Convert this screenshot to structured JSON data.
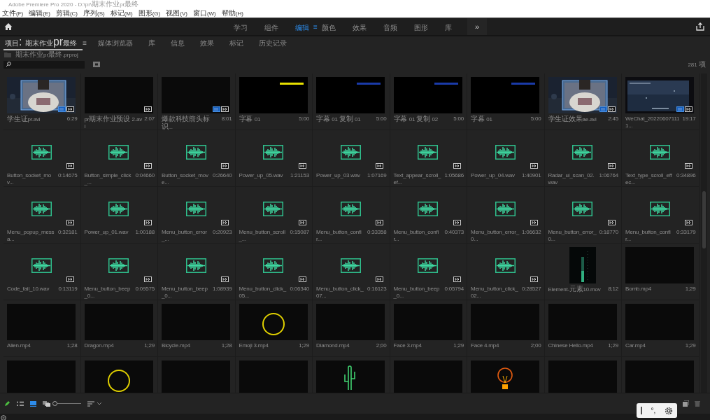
{
  "window": {
    "title": "Adobe Premiere Pro 2020 - D:\\pr\\期末作业pr最终"
  },
  "menu": [
    "文件(F)",
    "编辑(E)",
    "剪辑(C)",
    "序列(S)",
    "标记(M)",
    "图形(G)",
    "视图(V)",
    "窗口(W)",
    "帮助(H)"
  ],
  "workspaces": [
    {
      "label": "学习",
      "selected": false
    },
    {
      "label": "组件",
      "selected": false
    },
    {
      "label": "编辑",
      "selected": true
    },
    {
      "label": "颜色",
      "selected": false
    },
    {
      "label": "效果",
      "selected": false
    },
    {
      "label": "音频",
      "selected": false
    },
    {
      "label": "图形",
      "selected": false
    },
    {
      "label": "库",
      "selected": false
    }
  ],
  "workspace_menu": "≡",
  "workspace_more": "»",
  "panel_tabs": [
    {
      "label": "项目: 期末作业pr最终",
      "selected": true
    },
    {
      "label": "媒体浏览器",
      "selected": false
    },
    {
      "label": "库",
      "selected": false
    },
    {
      "label": "信息",
      "selected": false
    },
    {
      "label": "效果",
      "selected": false
    },
    {
      "label": "标记",
      "selected": false
    },
    {
      "label": "历史记录",
      "selected": false
    }
  ],
  "panel_menu": "≡",
  "project_file": "期末作业pr最终.prproj",
  "item_count": "281 项",
  "items": [
    {
      "name": "学生证pr.avi",
      "duration": "6:29",
      "video_badge": true,
      "audio_badge": true
    },
    {
      "name": "pr期末作业预设 2.avi",
      "duration": "2:07",
      "kind": "black",
      "audio_badge": true
    },
    {
      "name": "爆款科技箭头标识...",
      "duration": "8:01",
      "kind": "black",
      "video_badge": true,
      "audio_badge": true
    },
    {
      "name": "字幕 01",
      "duration": "5:00",
      "kind": "caption",
      "color": "#e8e000"
    },
    {
      "name": "字幕 01 复制 01",
      "duration": "5:00",
      "kind": "caption",
      "color": "#1a3aa8"
    },
    {
      "name": "字幕 01 复制 02",
      "duration": "5:00",
      "kind": "caption",
      "color": "#1a3aa8"
    },
    {
      "name": "字幕 01",
      "duration": "5:00",
      "kind": "caption",
      "color": "#1a3aa8"
    },
    {
      "name": "学生证效果ae.avi",
      "duration": "2:45",
      "video_badge": true,
      "audio_badge": true
    },
    {
      "name": "WeChat_202206071111...",
      "duration": "19:17",
      "kind": "screen",
      "video_badge": true,
      "audio_badge": true
    },
    {
      "name": "Button_socket_mov...",
      "duration": "0:14675",
      "kind": "audio",
      "audio_badge": true
    },
    {
      "name": "Button_simple_click_...",
      "duration": "0:04660",
      "kind": "audio",
      "audio_badge": true
    },
    {
      "name": "Button_socket_move...",
      "duration": "0:26640",
      "kind": "audio",
      "audio_badge": true
    },
    {
      "name": "Power_up_05.wav",
      "duration": "1:21153",
      "kind": "audio",
      "audio_badge": true
    },
    {
      "name": "Power_up_03.wav",
      "duration": "1:07169",
      "kind": "audio",
      "audio_badge": true
    },
    {
      "name": "Text_appear_scroll_ef...",
      "duration": "1:05686",
      "kind": "audio",
      "audio_badge": true
    },
    {
      "name": "Power_up_04.wav",
      "duration": "1:40901",
      "kind": "audio",
      "audio_badge": true
    },
    {
      "name": "Radar_ui_scan_02.wav",
      "duration": "1:06764",
      "kind": "audio",
      "audio_badge": true
    },
    {
      "name": "Text_type_scroll_effec...",
      "duration": "0:34896",
      "kind": "audio",
      "audio_badge": true
    },
    {
      "name": "Menu_popup_messa...",
      "duration": "0:32181",
      "kind": "audio",
      "audio_badge": true
    },
    {
      "name": "Power_up_01.wav",
      "duration": "1:00188",
      "kind": "audio",
      "audio_badge": true
    },
    {
      "name": "Menu_button_error_...",
      "duration": "0:20923",
      "kind": "audio",
      "audio_badge": true
    },
    {
      "name": "Menu_button_scroll_...",
      "duration": "0:15087",
      "kind": "audio",
      "audio_badge": true
    },
    {
      "name": "Menu_button_confir...",
      "duration": "0:33358",
      "kind": "audio",
      "audio_badge": true
    },
    {
      "name": "Menu_button_confir...",
      "duration": "0:40373",
      "kind": "audio",
      "audio_badge": true
    },
    {
      "name": "Menu_button_error_0...",
      "duration": "1:06632",
      "kind": "audio",
      "audio_badge": true
    },
    {
      "name": "Menu_button_error_0...",
      "duration": "0:18770",
      "kind": "audio",
      "audio_badge": true
    },
    {
      "name": "Menu_button_confir...",
      "duration": "0:33179",
      "kind": "audio",
      "audio_badge": true
    },
    {
      "name": "Code_fail_10.wav",
      "duration": "0:13119",
      "kind": "audio",
      "audio_badge": true
    },
    {
      "name": "Menu_button_beep_0...",
      "duration": "0:09575",
      "kind": "audio",
      "audio_badge": true
    },
    {
      "name": "Menu_button_beep_0...",
      "duration": "1:08939",
      "kind": "audio",
      "audio_badge": true
    },
    {
      "name": "Menu_button_click_05...",
      "duration": "0:06340",
      "kind": "audio",
      "audio_badge": true
    },
    {
      "name": "Menu_button_click_07...",
      "duration": "0:16123",
      "kind": "audio",
      "audio_badge": true
    },
    {
      "name": "Menu_button_beep_0...",
      "duration": "0:05794",
      "kind": "audio",
      "audio_badge": true
    },
    {
      "name": "Menu_button_click_02...",
      "duration": "0:28527",
      "kind": "audio",
      "audio_badge": true
    },
    {
      "name": "Element-元素10.mov",
      "duration": "8;12",
      "kind": "meter"
    },
    {
      "name": "Bomb.mp4",
      "duration": "1;29",
      "kind": "black"
    },
    {
      "name": "Alien.mp4",
      "duration": "1;28",
      "kind": "black"
    },
    {
      "name": "Dragon.mp4",
      "duration": "1;29",
      "kind": "black"
    },
    {
      "name": "Bicycle.mp4",
      "duration": "1;28",
      "kind": "black"
    },
    {
      "name": "Emoji 3.mp4",
      "duration": "1;29",
      "kind": "circle"
    },
    {
      "name": "Diamond.mp4",
      "duration": "2;00",
      "kind": "black"
    },
    {
      "name": "Face 3.mp4",
      "duration": "1;29",
      "kind": "black"
    },
    {
      "name": "Face 4.mp4",
      "duration": "2;00",
      "kind": "black"
    },
    {
      "name": "Chinese Hello.mp4",
      "duration": "1;29",
      "kind": "black"
    },
    {
      "name": "Car.mp4",
      "duration": "1;29",
      "kind": "black"
    },
    {
      "kind": "black"
    },
    {
      "kind": "circle"
    },
    {
      "kind": "black"
    },
    {
      "kind": "black"
    },
    {
      "kind": "cactus"
    },
    {
      "kind": "black"
    },
    {
      "kind": "bulb"
    },
    {
      "kind": "black"
    },
    {
      "kind": "black"
    }
  ],
  "zoom": {
    "level": 0.0
  },
  "ime_toolbar": {
    "punctuation": "°,"
  }
}
